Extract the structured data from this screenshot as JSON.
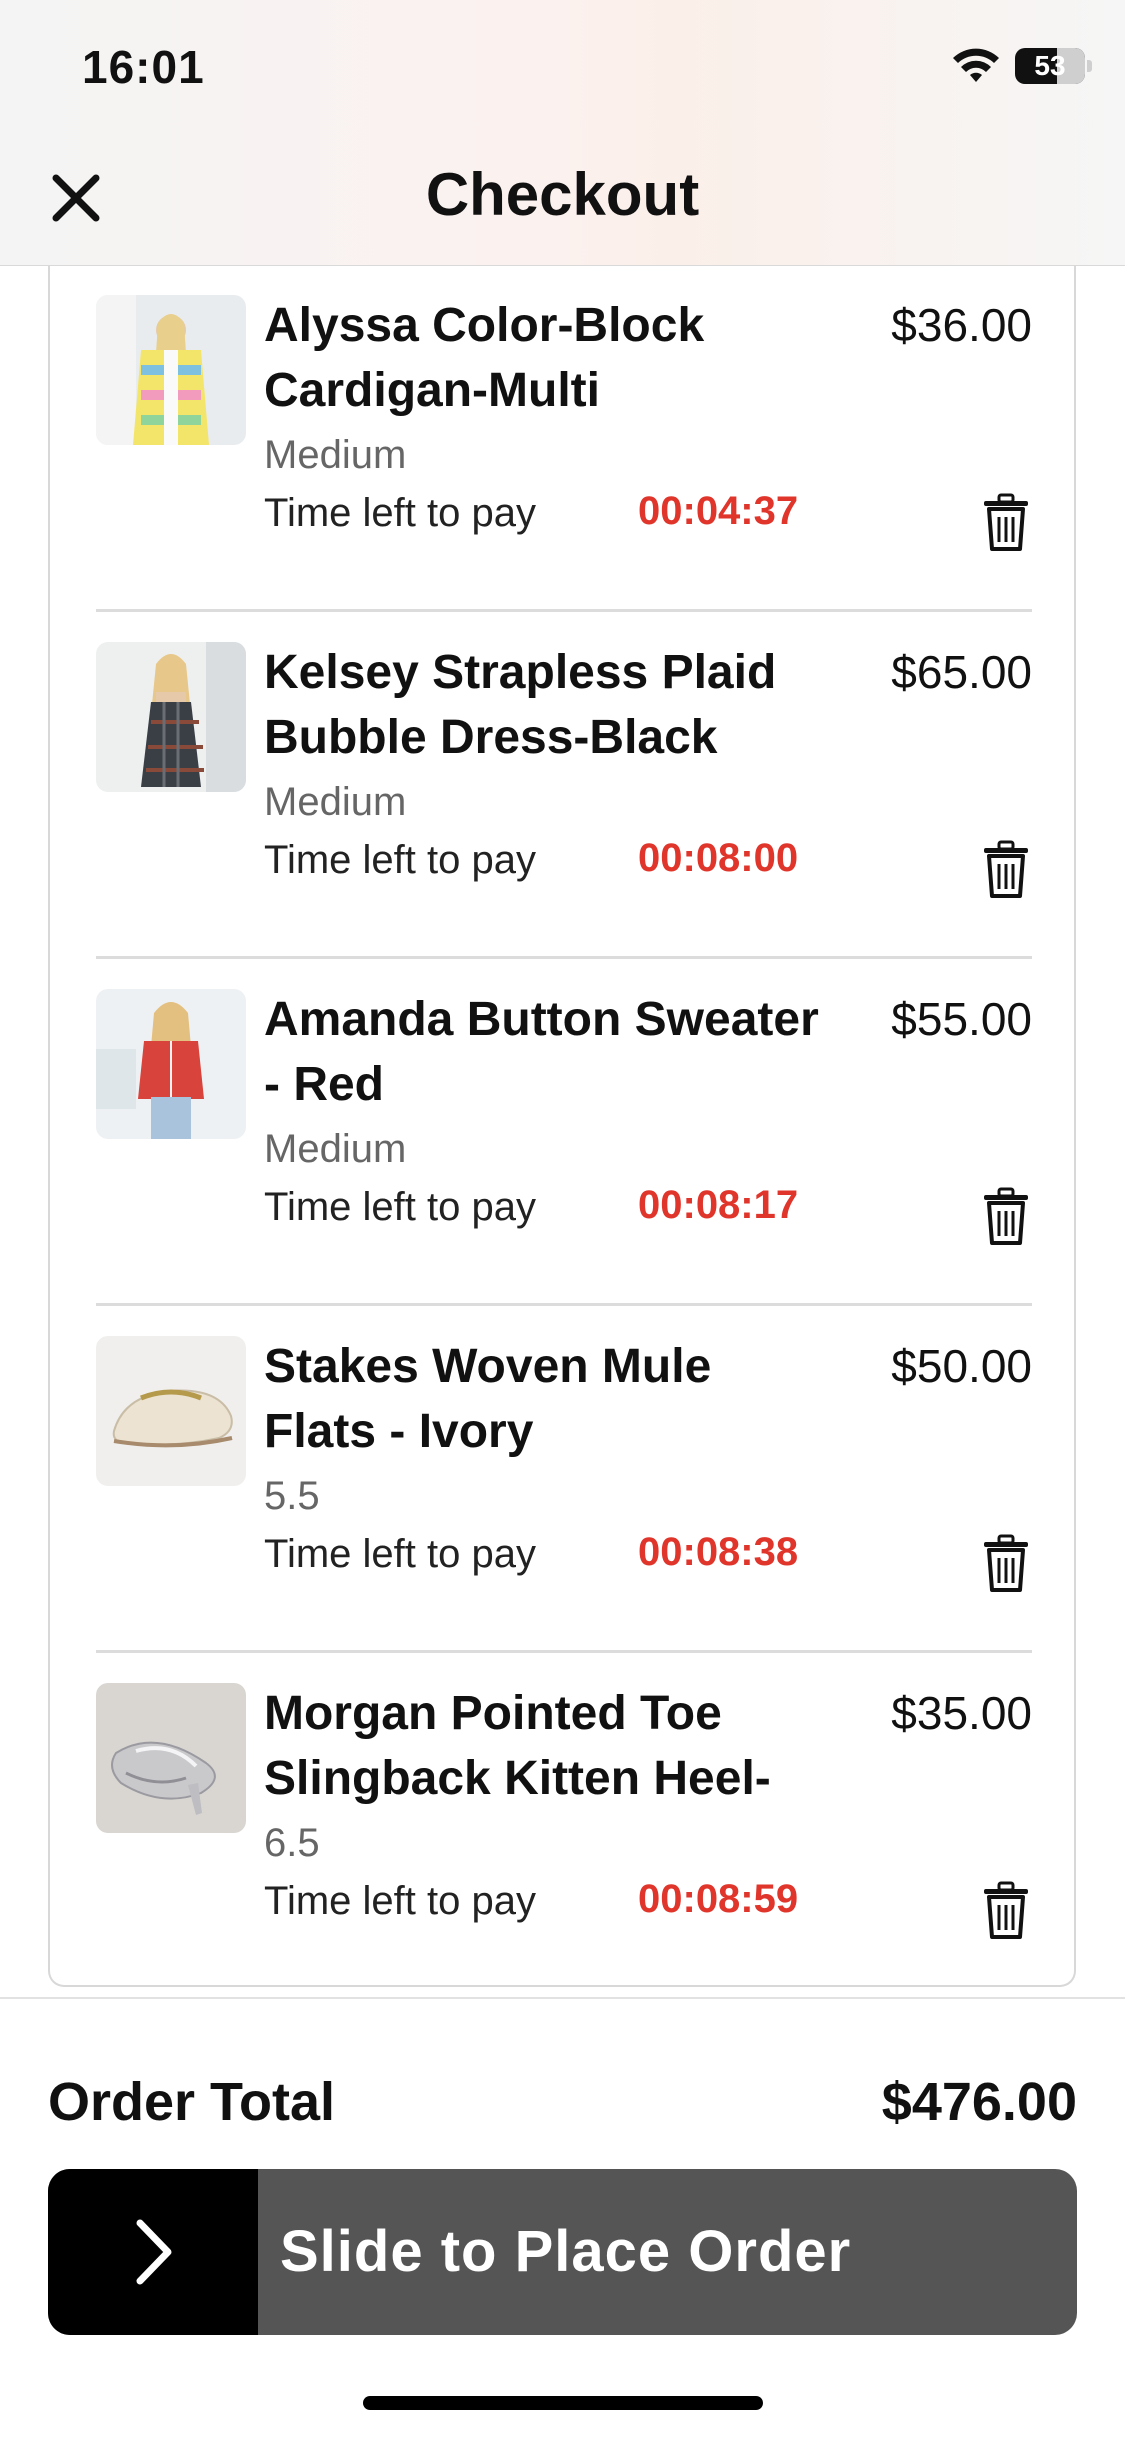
{
  "status_bar": {
    "time": "16:01",
    "battery": "53"
  },
  "header": {
    "title": "Checkout"
  },
  "cart": {
    "time_label": "Time left to pay",
    "items": [
      {
        "name": "Alyssa Color-Block Cardigan-Multi",
        "price": "$36.00",
        "variant": "Medium",
        "timer": "00:04:37"
      },
      {
        "name": "Kelsey Strapless Plaid Bubble Dress-Black",
        "price": "$65.00",
        "variant": "Medium",
        "timer": "00:08:00"
      },
      {
        "name": "Amanda Button Sweater - Red",
        "price": "$55.00",
        "variant": "Medium",
        "timer": "00:08:17"
      },
      {
        "name": "Stakes Woven Mule Flats - Ivory",
        "price": "$50.00",
        "variant": "5.5",
        "timer": "00:08:38"
      },
      {
        "name": "Morgan Pointed Toe Slingback Kitten Heel-",
        "price": "$35.00",
        "variant": "6.5",
        "timer": "00:08:59"
      }
    ]
  },
  "footer": {
    "total_label": "Order Total",
    "total_value": "$476.00",
    "slider_label": "Slide to Place Order"
  },
  "colors": {
    "timer": "#e0352b",
    "slider_track": "#555555",
    "slider_handle": "#000000"
  },
  "icons": [
    "wifi-icon",
    "battery-icon",
    "close-icon",
    "trash-icon",
    "chevron-right-icon"
  ]
}
